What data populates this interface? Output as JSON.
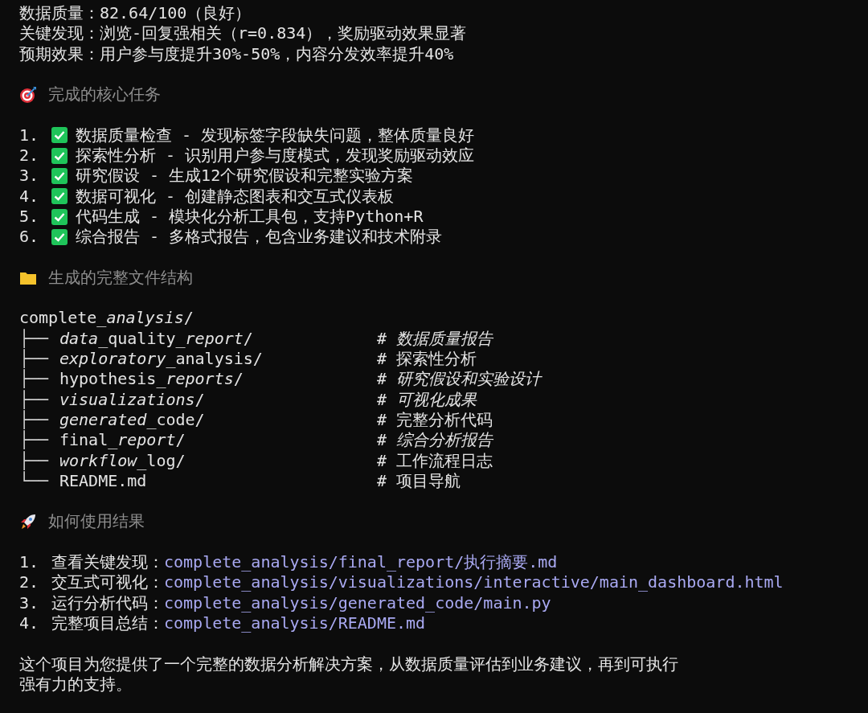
{
  "summary": [
    "数据质量：82.64/100（良好）",
    "关键发现：浏览-回复强相关（r=0.834），奖励驱动效果显著",
    "预期效果：用户参与度提升30%-50%，内容分发效率提升40%"
  ],
  "tasks_section": {
    "title": "完成的核心任务",
    "items": [
      {
        "number": "1.",
        "text": "数据质量检查 - 发现标签字段缺失问题，整体质量良好"
      },
      {
        "number": "2.",
        "text": "探索性分析 - 识别用户参与度模式，发现奖励驱动效应"
      },
      {
        "number": "3.",
        "text": "研究假设 - 生成12个研究假设和完整实验方案"
      },
      {
        "number": "4.",
        "text": "数据可视化 - 创建静态图表和交互式仪表板"
      },
      {
        "number": "5.",
        "text": "代码生成 - 模块化分析工具包，支持Python+R"
      },
      {
        "number": "6.",
        "text": "综合报告 - 多格式报告，包含业务建议和技术附录"
      }
    ]
  },
  "files_section": {
    "title": "生成的完整文件结构",
    "root": [
      {
        "text": "complete_",
        "italic": false
      },
      {
        "text": "analysis",
        "italic": true
      },
      {
        "text": "/",
        "italic": false
      }
    ],
    "entries": [
      {
        "branch": "├──",
        "name": [
          {
            "text": "data",
            "italic": true
          },
          {
            "text": "_quality_",
            "italic": false
          },
          {
            "text": "report",
            "italic": true
          },
          {
            "text": "/",
            "italic": false
          }
        ],
        "comment": "# *数据质量报告*"
      },
      {
        "branch": "├──",
        "name": [
          {
            "text": "exploratory",
            "italic": true
          },
          {
            "text": "_analysis/",
            "italic": false
          }
        ],
        "comment": "# 探索性分析"
      },
      {
        "branch": "├──",
        "name": [
          {
            "text": "hypothesis_",
            "italic": false
          },
          {
            "text": "reports",
            "italic": true
          },
          {
            "text": "/",
            "italic": false
          }
        ],
        "comment": "# *研究假设和实验设计*"
      },
      {
        "branch": "├──",
        "name": [
          {
            "text": "visualizations",
            "italic": true
          },
          {
            "text": "/",
            "italic": false
          }
        ],
        "comment": "# *可视化成果*"
      },
      {
        "branch": "├──",
        "name": [
          {
            "text": "generated",
            "italic": true
          },
          {
            "text": "_code/",
            "italic": false
          }
        ],
        "comment": "# 完整分析代码"
      },
      {
        "branch": "├──",
        "name": [
          {
            "text": "final_",
            "italic": false
          },
          {
            "text": "report",
            "italic": true
          },
          {
            "text": "/",
            "italic": false
          }
        ],
        "comment": "# *综合分析报告*"
      },
      {
        "branch": "├──",
        "name": [
          {
            "text": "workflow",
            "italic": true
          },
          {
            "text": "_log/",
            "italic": false
          }
        ],
        "comment": "# 工作流程日志"
      },
      {
        "branch": "└──",
        "name": [
          {
            "text": "README.md",
            "italic": false
          }
        ],
        "comment": "# 项目导航"
      }
    ]
  },
  "usage_section": {
    "title": "如何使用结果",
    "items": [
      {
        "number": "1.",
        "label": "查看关键发现：",
        "path": "complete_analysis/final_report/执行摘要.md"
      },
      {
        "number": "2.",
        "label": "交互式可视化：",
        "path": "complete_analysis/visualizations/interactive/main_dashboard.html"
      },
      {
        "number": "3.",
        "label": "运行分析代码：",
        "path": "complete_analysis/generated_code/main.py"
      },
      {
        "number": "4.",
        "label": "完整项目总结：",
        "path": "complete_analysis/README.md"
      }
    ]
  },
  "closing_lines": [
    "这个项目为您提供了一个完整的数据分析解决方案，从数据质量评估到业务建议，再到可执行",
    "强有力的支持。"
  ]
}
